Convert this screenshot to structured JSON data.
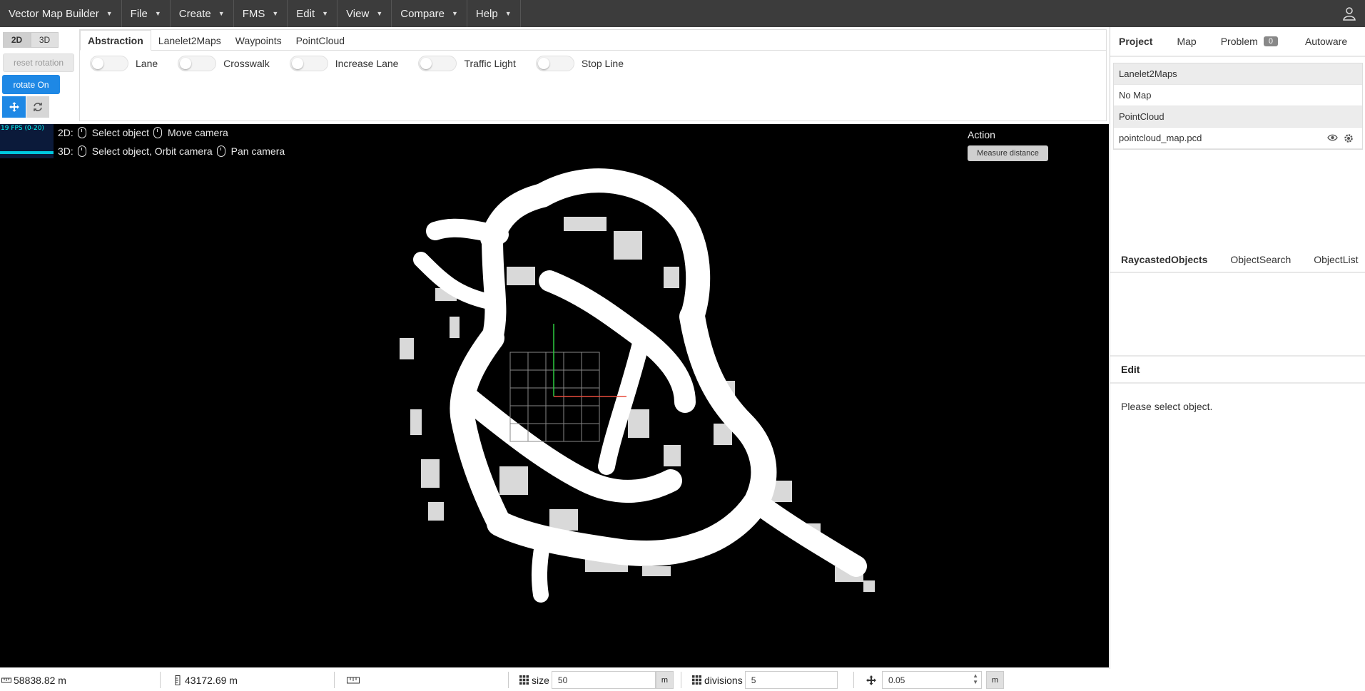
{
  "menubar": {
    "items": [
      "Vector Map Builder",
      "File",
      "Create",
      "FMS",
      "Edit",
      "View",
      "Compare",
      "Help"
    ],
    "user_icon": "user-icon"
  },
  "left_tools": {
    "view_2d": "2D",
    "view_3d": "3D",
    "reset_rotation": "reset rotation",
    "rotate": "rotate On",
    "move_icon": "move-icon",
    "sync_icon": "sync-icon"
  },
  "tabs": [
    "Abstraction",
    "Lanelet2Maps",
    "Waypoints",
    "PointCloud"
  ],
  "toggles": [
    "Lane",
    "Crosswalk",
    "Increase Lane",
    "Traffic Light",
    "Stop Line"
  ],
  "viewport": {
    "fps": "19 FPS (0-20)",
    "hint_2d_prefix": "2D:",
    "hint_2d_a": "Select object",
    "hint_2d_b": "Move camera",
    "hint_3d_prefix": "3D:",
    "hint_3d_a": "Select object, Orbit camera",
    "hint_3d_b": "Pan camera",
    "action_title": "Action",
    "measure_button": "Measure distance"
  },
  "right_panel": {
    "tabs": [
      "Project",
      "Map",
      "Problem",
      "Autoware"
    ],
    "problem_count": "0",
    "lanelet_header": "Lanelet2Maps",
    "lanelet_value": "No Map",
    "pointcloud_header": "PointCloud",
    "pointcloud_file": "pointcloud_map.pcd",
    "tabs2": [
      "RaycastedObjects",
      "ObjectSearch",
      "ObjectList"
    ],
    "edit_title": "Edit",
    "edit_message": "Please select object."
  },
  "status": {
    "width_value": "58838.82 m",
    "height_value": "43172.69 m",
    "size_label": "size",
    "size_value": "50",
    "size_unit": "m",
    "divisions_label": "divisions",
    "divisions_value": "5",
    "step_value": "0.05",
    "step_unit": "m"
  }
}
